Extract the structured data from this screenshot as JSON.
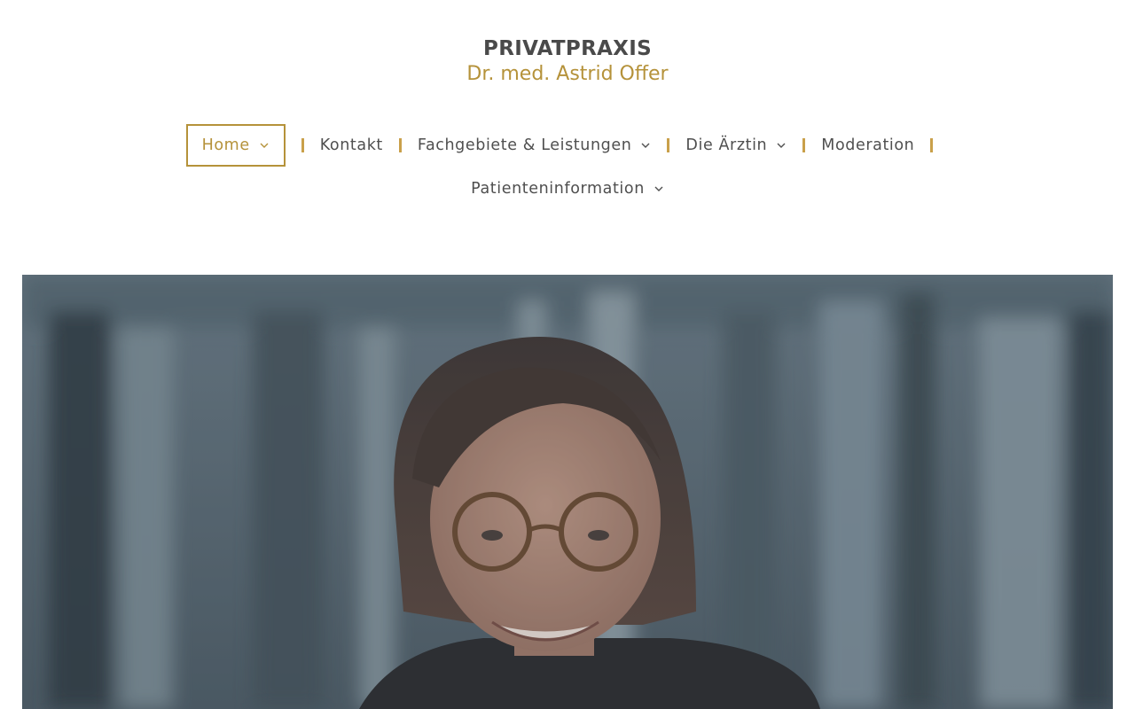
{
  "brand": {
    "title": "PRIVATPRAXIS",
    "subtitle": "Dr. med. Astrid Offer"
  },
  "nav": {
    "home": "Home",
    "kontakt": "Kontakt",
    "fachgebiete": "Fachgebiete & Leistungen",
    "aerztin": "Die Ärztin",
    "moderation": "Moderation",
    "patienteninformation": "Patienteninformation"
  },
  "colors": {
    "accent": "#b5923a",
    "text": "#4f4f4f",
    "separator": "#c9a04a"
  },
  "hero": {
    "image": "portrait-photo"
  }
}
